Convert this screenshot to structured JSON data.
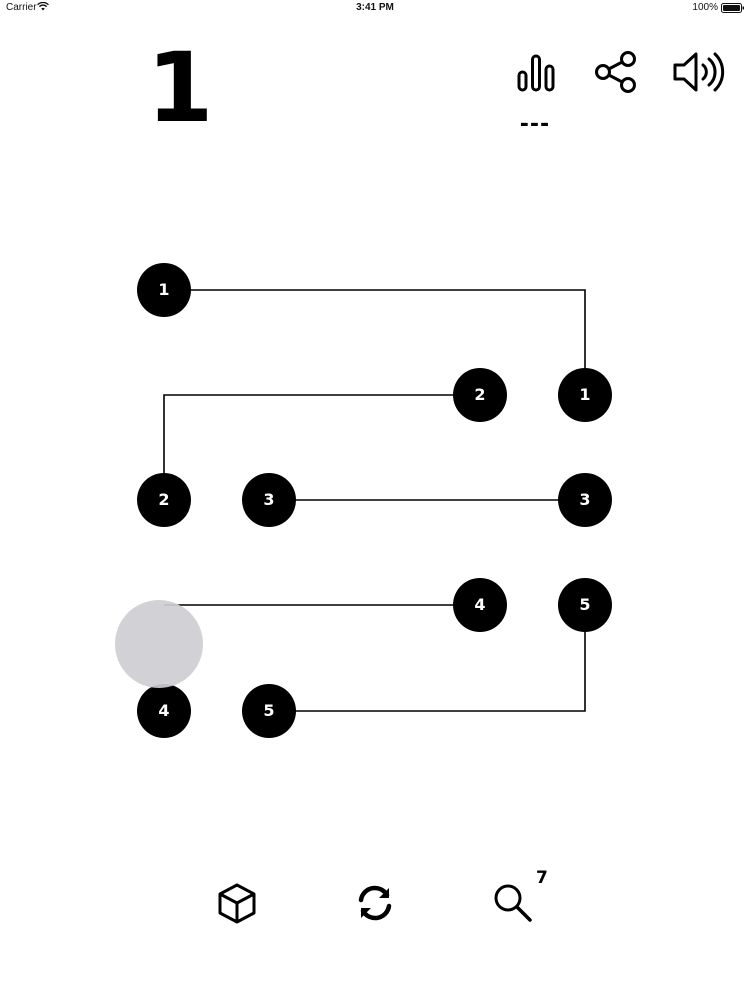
{
  "status_bar": {
    "carrier": "Carrier",
    "time": "3:41 PM",
    "battery": "100%"
  },
  "header": {
    "level": "1",
    "best": "---",
    "icons": [
      "stats-icon",
      "share-icon",
      "sound-icon"
    ]
  },
  "board": {
    "nodes": [
      {
        "label": "1",
        "row": 0,
        "col": 0
      },
      {
        "label": "2",
        "row": 1,
        "col": 3
      },
      {
        "label": "1",
        "row": 1,
        "col": 4
      },
      {
        "label": "2",
        "row": 2,
        "col": 0
      },
      {
        "label": "3",
        "row": 2,
        "col": 1
      },
      {
        "label": "3",
        "row": 2,
        "col": 4
      },
      {
        "label": "4",
        "row": 3,
        "col": 3
      },
      {
        "label": "5",
        "row": 3,
        "col": 4
      },
      {
        "label": "4",
        "row": 4,
        "col": 0
      },
      {
        "label": "5",
        "row": 4,
        "col": 1
      }
    ],
    "connections": [
      {
        "pair": "1",
        "path": [
          [
            0,
            0
          ],
          [
            0,
            4
          ],
          [
            1,
            4
          ]
        ]
      },
      {
        "pair": "2",
        "path": [
          [
            1,
            3
          ],
          [
            1,
            0
          ],
          [
            2,
            0
          ]
        ]
      },
      {
        "pair": "3",
        "path": [
          [
            2,
            1
          ],
          [
            2,
            4
          ]
        ]
      },
      {
        "pair": "4",
        "path": [
          [
            3,
            3
          ],
          [
            3,
            0
          ]
        ],
        "in_progress": true
      },
      {
        "pair": "5",
        "path": [
          [
            3,
            4
          ],
          [
            4,
            4
          ],
          [
            4,
            1
          ]
        ]
      }
    ]
  },
  "footer": {
    "icons": [
      "cube-icon",
      "refresh-icon",
      "search-icon"
    ],
    "hints": "7"
  },
  "colors": {
    "node": "#000000",
    "node_text": "#ffffff",
    "line": "#000000",
    "touch": "#cdcdd2"
  }
}
